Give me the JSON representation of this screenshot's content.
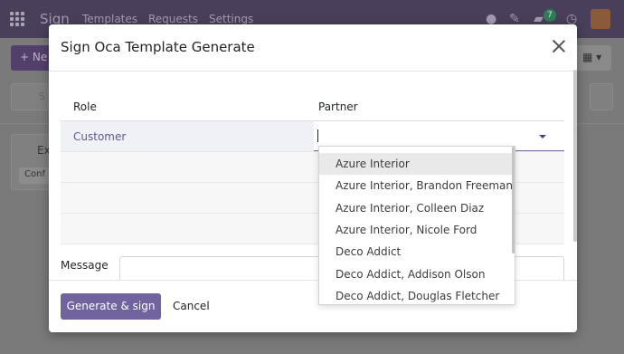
{
  "background": {
    "brand": "Sign",
    "menu": [
      "Templates",
      "Requests",
      "Settings"
    ],
    "new_label": "Ne",
    "search_placeholder": "S",
    "card_title": "Ex",
    "card_tag": "Conf",
    "notification_count": "7"
  },
  "modal": {
    "title": "Sign Oca Template Generate",
    "columns": {
      "role": "Role",
      "partner": "Partner"
    },
    "rows": [
      {
        "role": "Customer",
        "partner": ""
      }
    ],
    "message_label": "Message",
    "message_value": "",
    "generate_label": "Generate & sign",
    "cancel_label": "Cancel"
  },
  "partner_options": [
    "Azure Interior",
    "Azure Interior, Brandon Freeman",
    "Azure Interior, Colleen Diaz",
    "Azure Interior, Nicole Ford",
    "Deco Addict",
    "Deco Addict, Addison Olson",
    "Deco Addict, Douglas Fletcher"
  ],
  "colors": {
    "accent": "#71639e",
    "topbar": "#4a3f5a",
    "role_text": "#5e5a8a"
  }
}
